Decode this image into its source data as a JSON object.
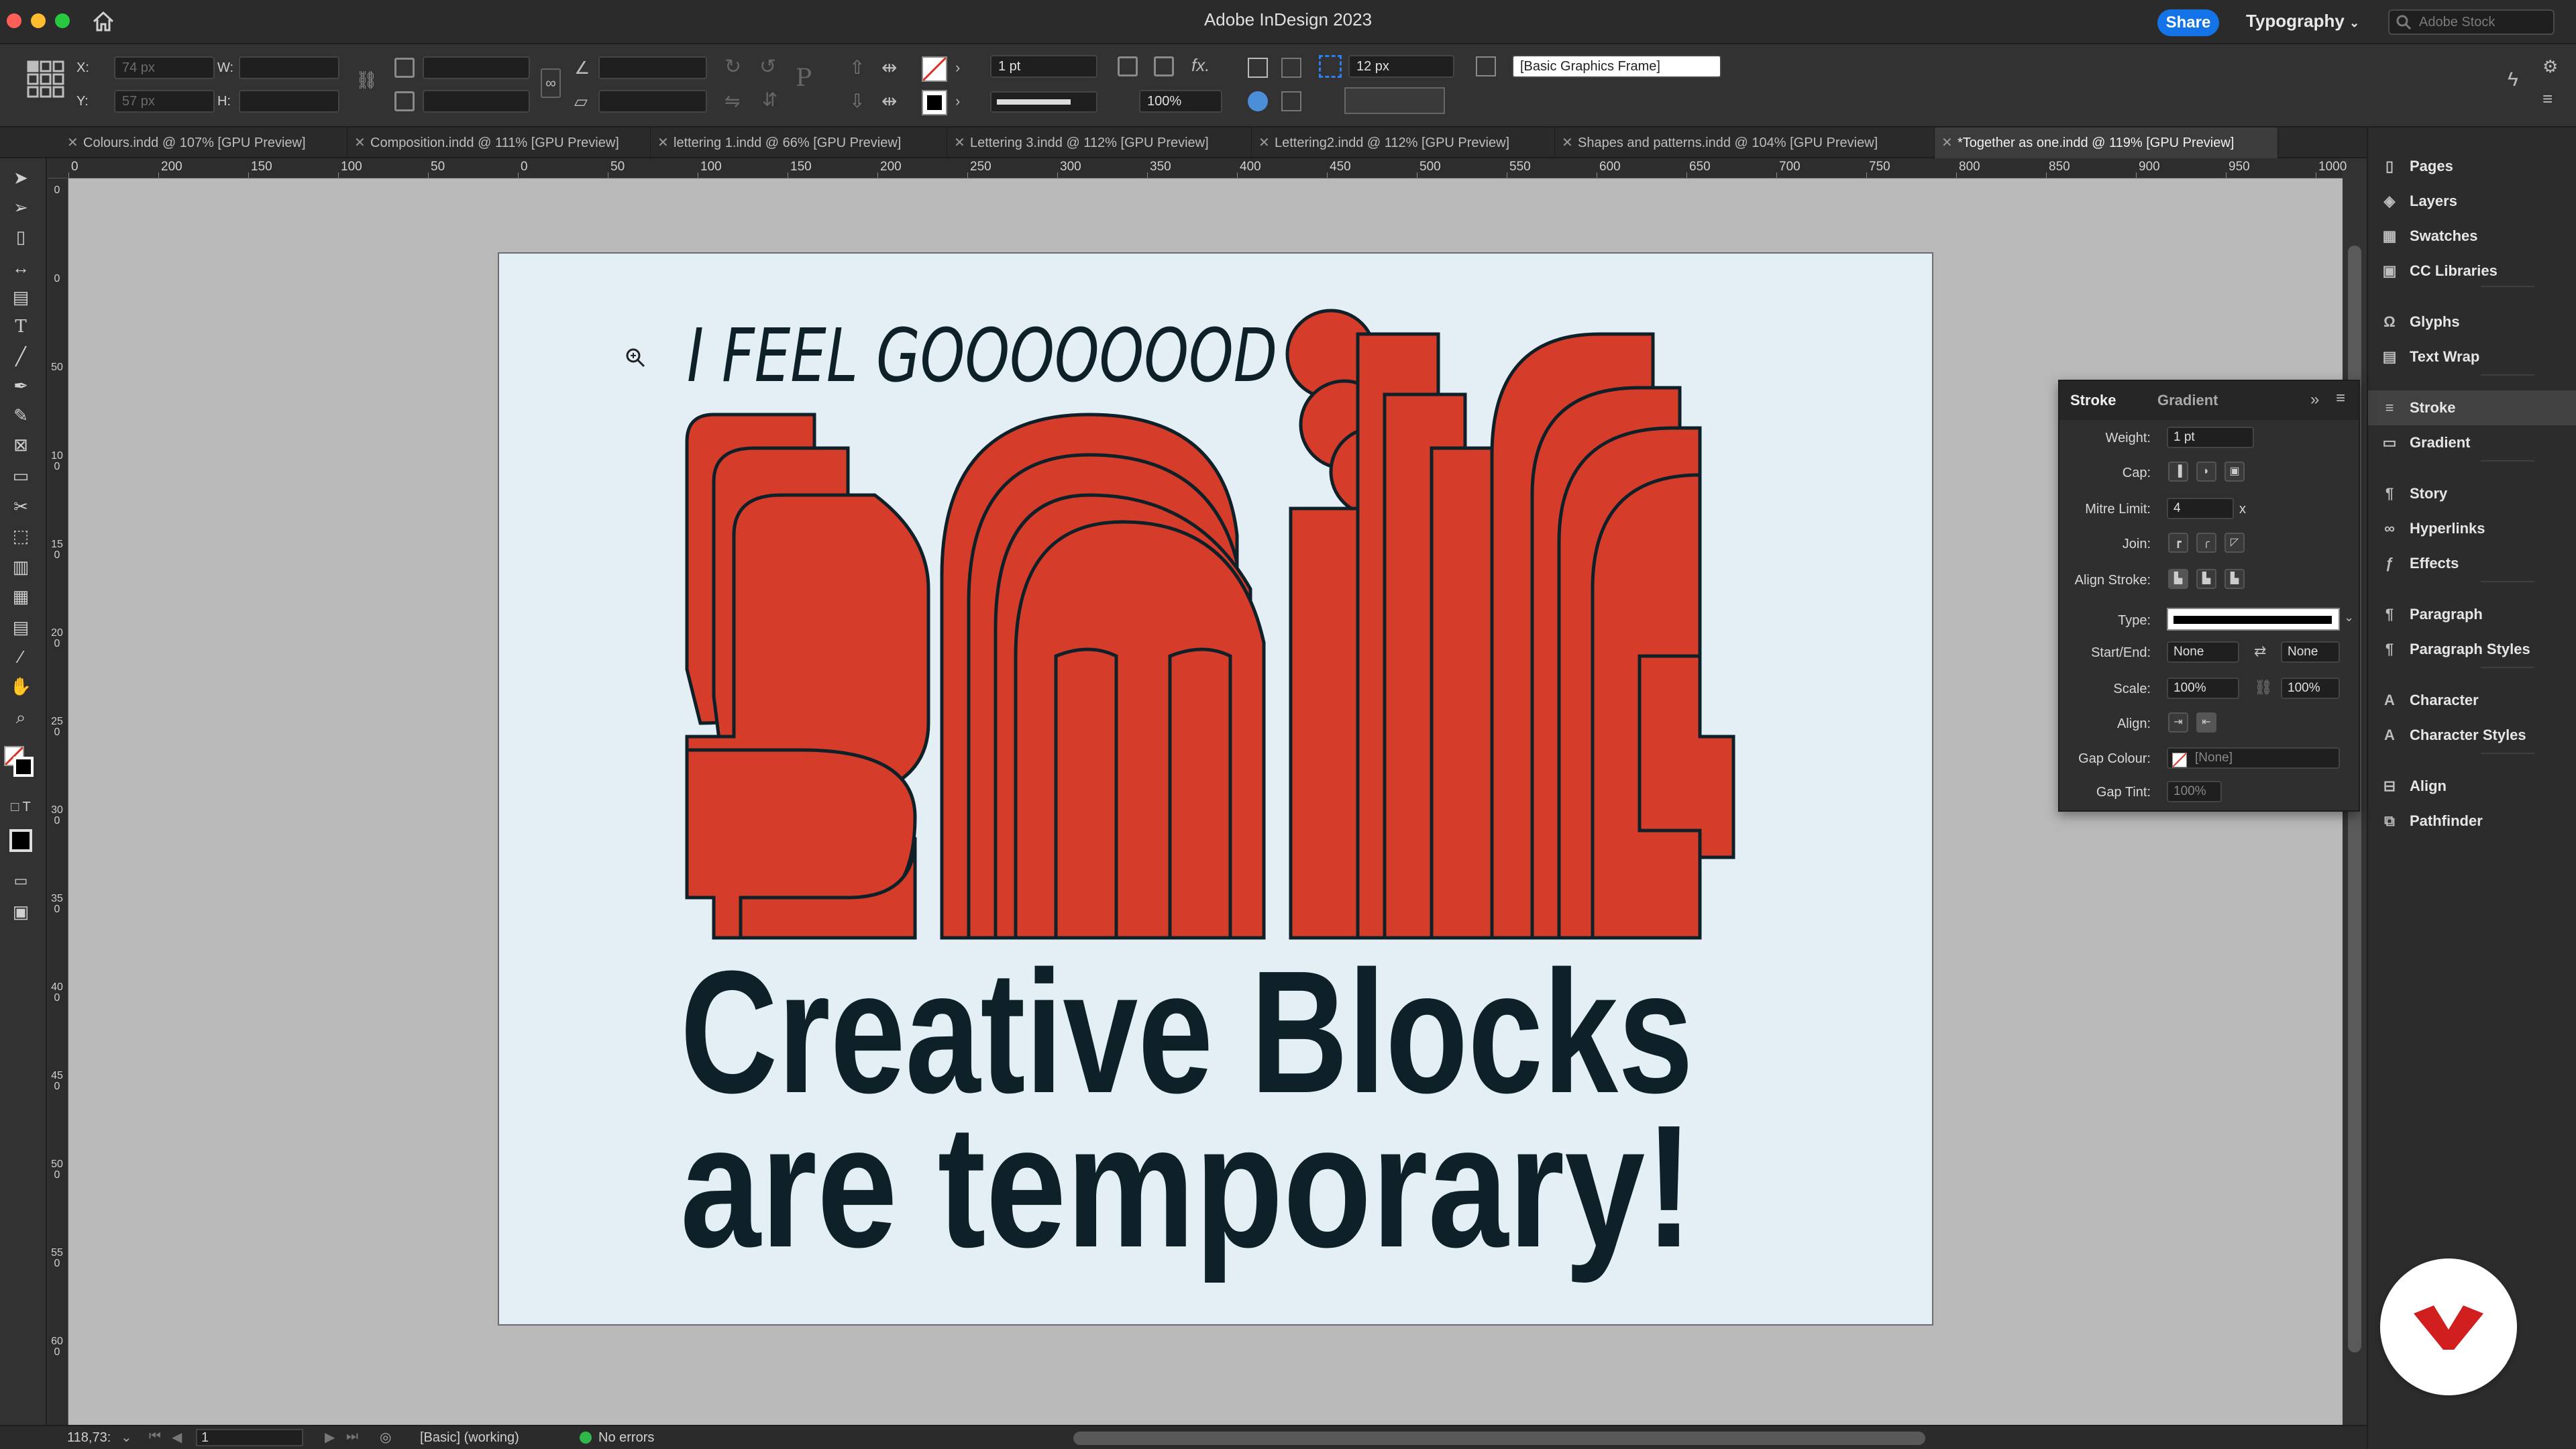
{
  "app": {
    "title": "Adobe InDesign 2023",
    "share_label": "Share",
    "workspace": "Typography",
    "stock_placeholder": "Adobe Stock"
  },
  "controlbar": {
    "x_label": "X:",
    "x_value": "74 px",
    "y_label": "Y:",
    "y_value": "57 px",
    "w_label": "W:",
    "h_label": "H:",
    "stroke_weight": "1 pt",
    "scale_value": "100%",
    "corner_size": "12 px",
    "object_style": "[Basic Graphics Frame]",
    "fx_label": "fx."
  },
  "tabs": [
    {
      "label": "Colours.indd @ 107% [GPU Preview]"
    },
    {
      "label": "Composition.indd @ 111% [GPU Preview]"
    },
    {
      "label": "lettering 1.indd @ 66% [GPU Preview]"
    },
    {
      "label": "Lettering 3.indd @ 112% [GPU Preview]"
    },
    {
      "label": "Lettering2.indd @ 112% [GPU Preview]"
    },
    {
      "label": "Shapes and patterns.indd @ 104% [GPU Preview]"
    },
    {
      "label": "*Together as one.indd @ 119% [GPU Preview]"
    }
  ],
  "ruler_h": [
    "0",
    "200",
    "150",
    "100",
    "50",
    "0",
    "50",
    "100",
    "150",
    "200",
    "250",
    "300",
    "350",
    "400",
    "450",
    "500",
    "550",
    "600",
    "650",
    "700",
    "750",
    "800",
    "850",
    "900",
    "950",
    "1000"
  ],
  "ruler_v": [
    "0",
    "0",
    "50",
    "100",
    "150",
    "200",
    "250",
    "300",
    "350",
    "400",
    "450",
    "500",
    "550",
    "600"
  ],
  "artwork": {
    "top_line": "I FEEL GOOOOOOOD",
    "big_word": "SMILE",
    "line1": "Creative Blocks",
    "line2": "are temporary!"
  },
  "colors": {
    "accent": "#d63c2a",
    "ink": "#0e2028",
    "page": "#e3eff5",
    "share": "#1473e6"
  },
  "dock": {
    "items": [
      "Pages",
      "Layers",
      "Swatches",
      "CC Libraries",
      "Glyphs",
      "Text Wrap",
      "Stroke",
      "Gradient",
      "Story",
      "Hyperlinks",
      "Effects",
      "Paragraph",
      "Paragraph Styles",
      "Character",
      "Character Styles",
      "Align",
      "Pathfinder"
    ],
    "icons": [
      "pages-icon",
      "layers-icon",
      "swatches-icon",
      "cc-libraries-icon",
      "glyphs-icon",
      "text-wrap-icon",
      "stroke-icon",
      "gradient-icon",
      "story-icon",
      "hyperlinks-icon",
      "effects-icon",
      "paragraph-icon",
      "paragraph-styles-icon",
      "character-icon",
      "character-styles-icon",
      "align-icon",
      "pathfinder-icon"
    ]
  },
  "stroke_panel": {
    "tab_stroke": "Stroke",
    "tab_gradient": "Gradient",
    "weight_label": "Weight:",
    "weight_value": "1 pt",
    "cap_label": "Cap:",
    "mitre_label": "Mitre Limit:",
    "mitre_value": "4",
    "mitre_unit": "x",
    "join_label": "Join:",
    "align_stroke_label": "Align Stroke:",
    "type_label": "Type:",
    "start_end_label": "Start/End:",
    "start_value": "None",
    "end_value": "None",
    "scale_label": "Scale:",
    "scale_start": "100%",
    "scale_end": "100%",
    "align_label": "Align:",
    "gap_colour_label": "Gap Colour:",
    "gap_colour_value": "[None]",
    "gap_tint_label": "Gap Tint:",
    "gap_tint_value": "100%"
  },
  "status": {
    "zoom": "118,73:",
    "page": "1",
    "preflight_profile": "[Basic] (working)",
    "errors": "No errors"
  }
}
